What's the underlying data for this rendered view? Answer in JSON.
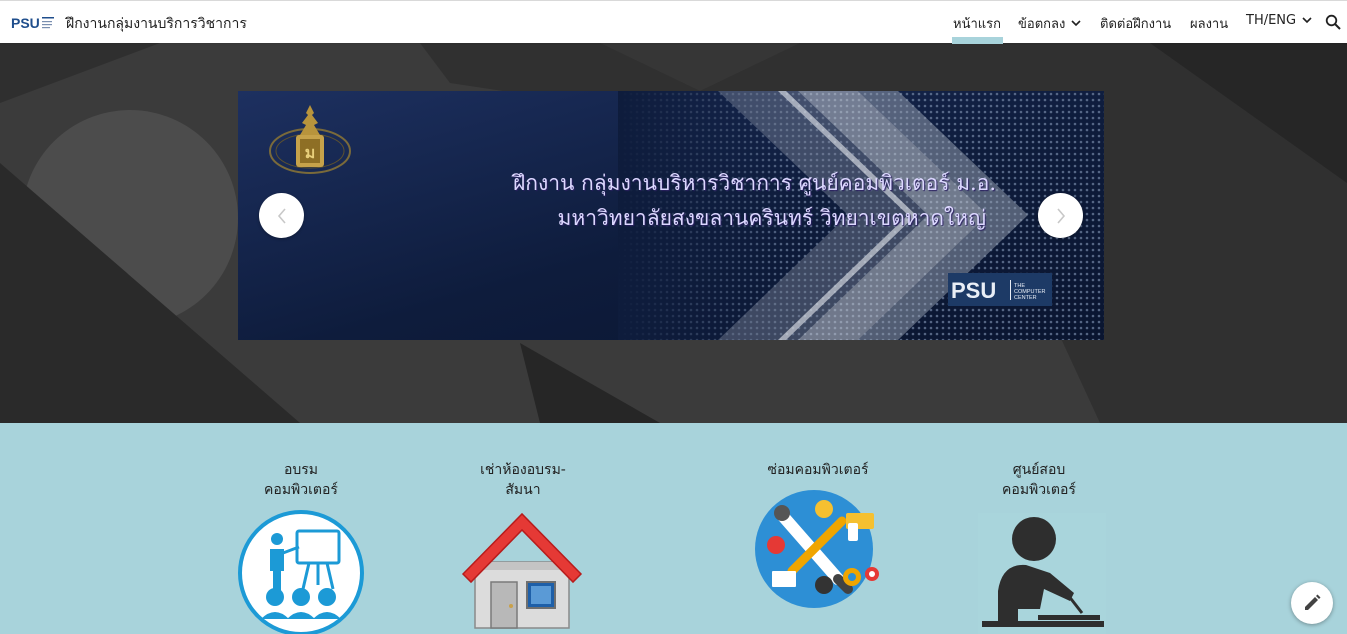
{
  "header": {
    "site_title": "ฝึกงานกลุ่มงานบริการวิชาการ",
    "logo_text": "PSU",
    "nav": [
      {
        "label": "หน้าแรก",
        "active": true
      },
      {
        "label": "ข้อตกลง",
        "has_dropdown": true
      },
      {
        "label": "ติดต่อฝึกงาน"
      },
      {
        "label": "ผลงาน"
      },
      {
        "label": "TH/ENG",
        "has_dropdown": true
      }
    ],
    "search_icon": "search-icon"
  },
  "hero": {
    "slide": {
      "line1": "ฝึกงาน กลุ่มงานบริหารวิชาการ ศูนย์คอมพิวเตอร์ ม.อ.",
      "line2": "มหาวิทยาลัยสงขลานครินทร์  วิทยาเขตหาดใหญ่",
      "logo_text": "PSU",
      "logo_caption": "THE COMPUTER CENTER"
    },
    "prev_icon": "chevron-left-icon",
    "next_icon": "chevron-right-icon"
  },
  "services": [
    {
      "title_line1": "อบรม",
      "title_line2": "คอมพิวเตอร์",
      "icon": "training-presentation-icon"
    },
    {
      "title_line1": "เช่าห้องอบรม-",
      "title_line2": "สัมนา",
      "icon": "house-icon"
    },
    {
      "title_line1": "ซ่อมคอมพิวเตอร์",
      "title_line2": "",
      "icon": "repair-tools-icon"
    },
    {
      "title_line1": "ศูนย์สอบ",
      "title_line2": "คอมพิวเตอร์",
      "icon": "exam-writing-icon"
    }
  ],
  "colors": {
    "accent": "#a8d3db",
    "hero_background": "#3a3a3a",
    "slide_text": "#dcd7ff"
  },
  "fab": {
    "icon": "pencil-edit-icon"
  }
}
